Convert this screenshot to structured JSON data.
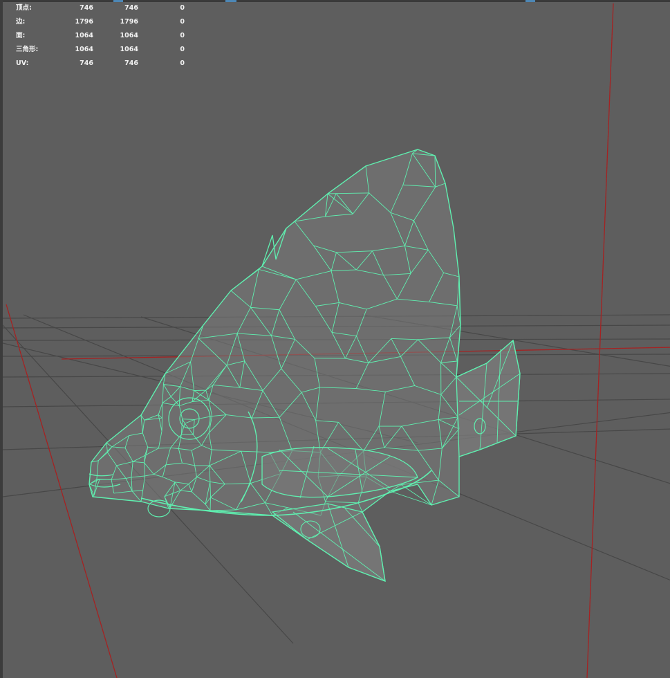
{
  "hud": {
    "rows": [
      {
        "label": "顶点:",
        "total": "746",
        "selected": "746",
        "extra": "0"
      },
      {
        "label": "边:",
        "total": "1796",
        "selected": "1796",
        "extra": "0"
      },
      {
        "label": "面:",
        "total": "1064",
        "selected": "1064",
        "extra": "0"
      },
      {
        "label": "三角形:",
        "total": "1064",
        "selected": "1064",
        "extra": "0"
      },
      {
        "label": "UV:",
        "total": "746",
        "selected": "746",
        "extra": "0"
      }
    ]
  },
  "colors": {
    "background": "#5e5e5e",
    "grid": "#474747",
    "axis": "#a52222",
    "wireframe": "#5ff0b0",
    "mesh_fill": "#7b7b7b"
  },
  "viewport": {
    "object": "wireframe fish model",
    "selection_state": "selected"
  }
}
